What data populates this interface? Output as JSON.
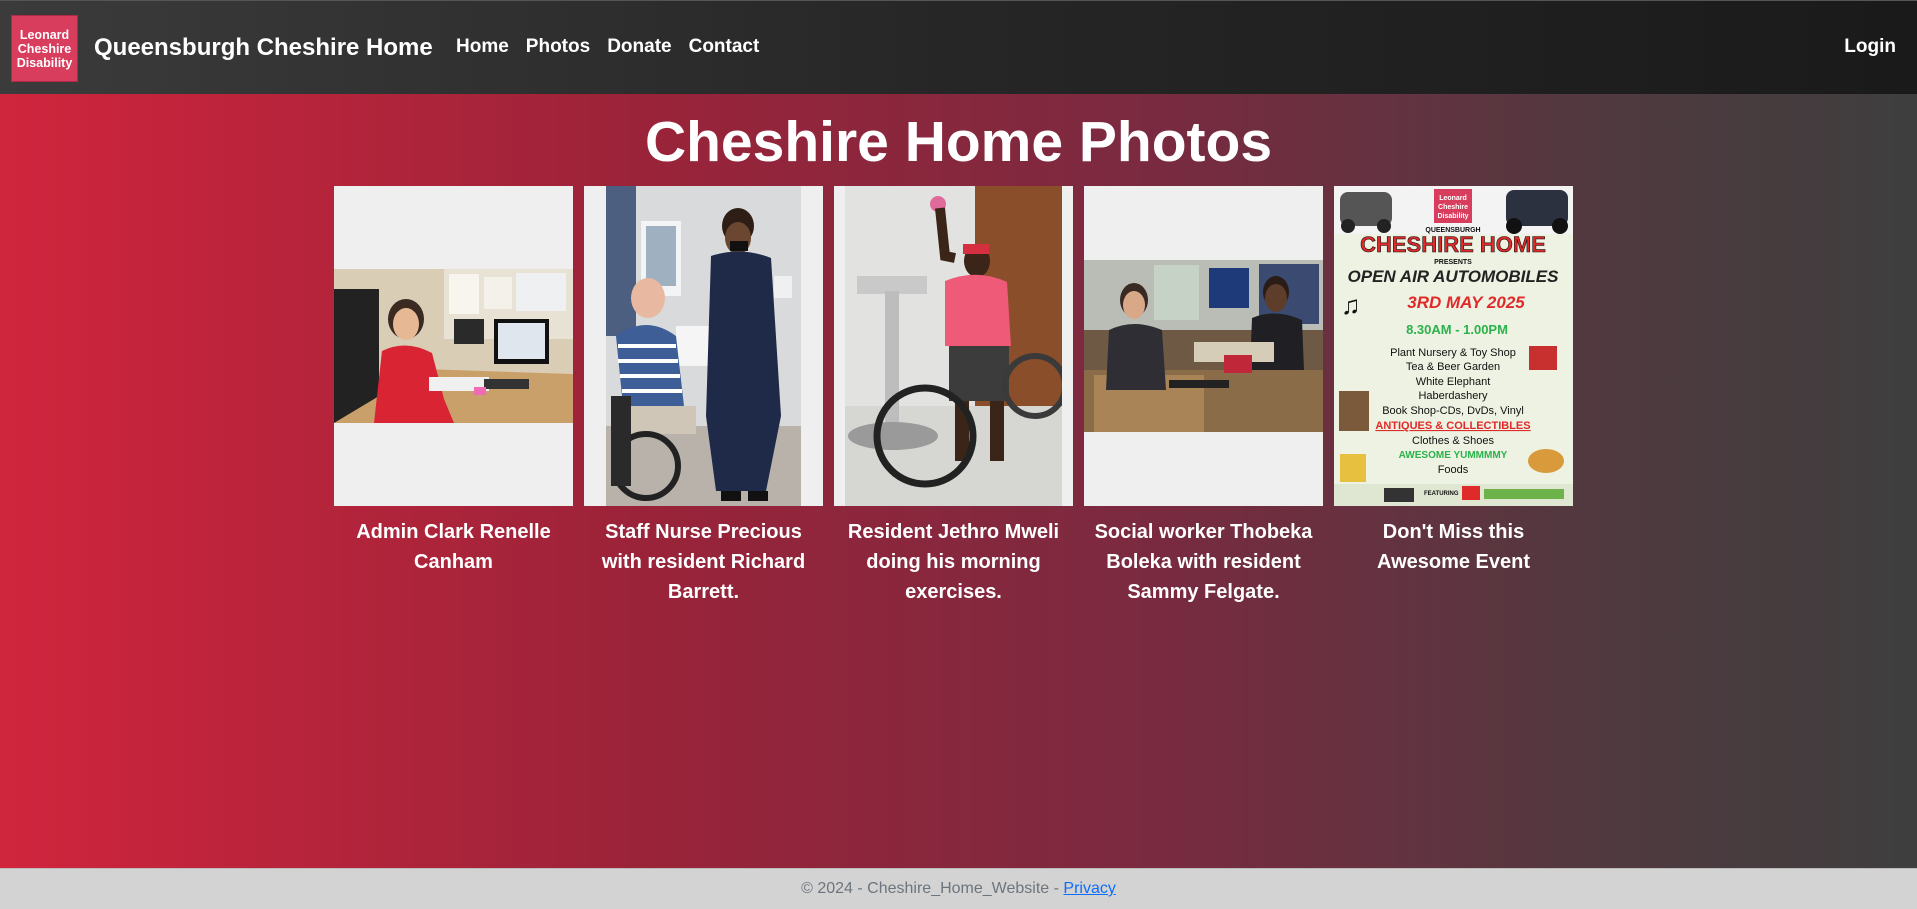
{
  "nav": {
    "logo_lines": [
      "Leonard",
      "Cheshire",
      "Disability"
    ],
    "brand": "Queensburgh Cheshire Home",
    "links": [
      "Home",
      "Photos",
      "Donate",
      "Contact"
    ],
    "login": "Login"
  },
  "main": {
    "title": "Cheshire Home Photos",
    "cards": [
      {
        "caption": "Admin Clark Renelle Canham"
      },
      {
        "caption": "Staff Nurse Precious with resident Richard Barrett."
      },
      {
        "caption": "Resident Jethro Mweli doing his morning exercises."
      },
      {
        "caption": "Social worker Thobeka Boleka with resident Sammy Felgate."
      },
      {
        "caption": "Don't Miss this Awesome Event"
      }
    ],
    "poster": {
      "logo_lines": [
        "Leonard",
        "Cheshire",
        "Disability"
      ],
      "venue": "QUEENSBURGH",
      "headline": "CHESHIRE HOME",
      "presents": "PRESENTS",
      "event": "OPEN AIR AUTOMOBILES",
      "date": "3RD MAY 2025",
      "time": "8.30AM - 1.00PM",
      "items": [
        "Plant Nursery & Toy Shop",
        "Tea & Beer Garden",
        "White Elephant",
        "Haberdashery",
        "Book Shop-CDs, DvDs, Vinyl"
      ],
      "highlight": "ANTIQUES & COLLECTIBLES",
      "items2": [
        "Clothes & Shoes"
      ],
      "yummy": "AWESOME YUMMMMY",
      "foods": "Foods",
      "featuring": "FEATURING"
    }
  },
  "footer": {
    "text": "© 2024 - Cheshire_Home_Website - ",
    "privacy": "Privacy"
  }
}
